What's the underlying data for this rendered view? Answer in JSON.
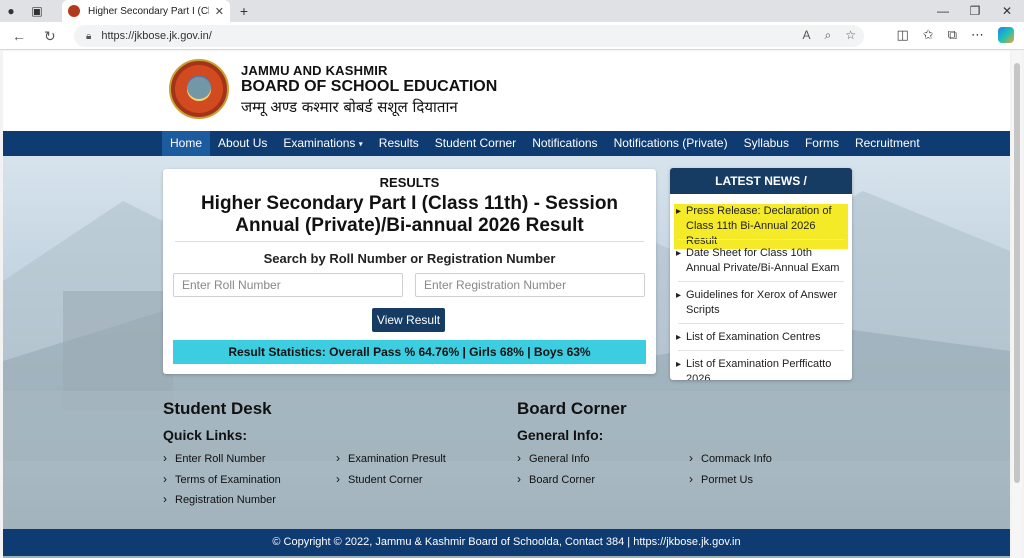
{
  "browser": {
    "tab_title": "Higher Secondary Part I (Class",
    "tab_close": "✕",
    "new_tab": "+",
    "url": "https://jkbose.jk.gov.in/"
  },
  "header": {
    "org_line1": "JAMMU AND KASHMIR",
    "org_line2": "BOARD OF SCHOOL EDUCATION",
    "org_line3": "जम्मू अण्ड कश्मार बोबर्ड सशूल दियातान"
  },
  "nav": {
    "items": [
      "Home",
      "About Us",
      "Examinations",
      "Results",
      "Student Corner",
      "Notifications",
      "Notifications (Private)",
      "Syllabus",
      "Forms",
      "Recruitment"
    ],
    "caret": "▾"
  },
  "results": {
    "heading": "RESULTS",
    "title": "Higher Secondary Part I (Class 11th) - Session Annual (Private)/Bi-annual 2026 Result",
    "search_heading": "Search by Roll Number or Registration Number",
    "roll_placeholder": "Enter Roll Number",
    "reg_placeholder": "Enter Registration Number",
    "button": "View Result",
    "stats": "Result Statistics: Overall Pass % 64.76% | Girls 68% | Boys 63%"
  },
  "news": {
    "heading": "LATEST NEWS / NOTIFICATIONS",
    "items": [
      "Press Release: Declaration of Class 11th Bi-Annual 2026 Result",
      "Date Sheet for Class 10th Annual Private/Bi-Annual Exam",
      "Guidelines for Xerox of Answer Scripts",
      "List of Examination Centres",
      "List of Examination Perfficatto 2026"
    ]
  },
  "student_desk": {
    "heading": "Student Desk",
    "sub": "Quick Links:",
    "links": [
      "Enter Roll Number",
      "Terms of Examination",
      "Registration Number",
      "Examination Presult",
      "Student Corner"
    ]
  },
  "board_corner": {
    "heading": "Board Corner",
    "sub": "General Info:",
    "links": [
      "General Info",
      "Board Corner",
      "Commack Info",
      "Pormet Us"
    ]
  },
  "footer": {
    "text": "© Copyright © 2022, Jammu & Kashmir Board of Schoolda, Contact 384 | https://jkbose.jk.gov.in"
  },
  "colors": {
    "nav_bg": "#0f3b73",
    "button_bg": "#163c64",
    "stats_bg": "#3ccde0",
    "highlight": "#f4ea27"
  }
}
